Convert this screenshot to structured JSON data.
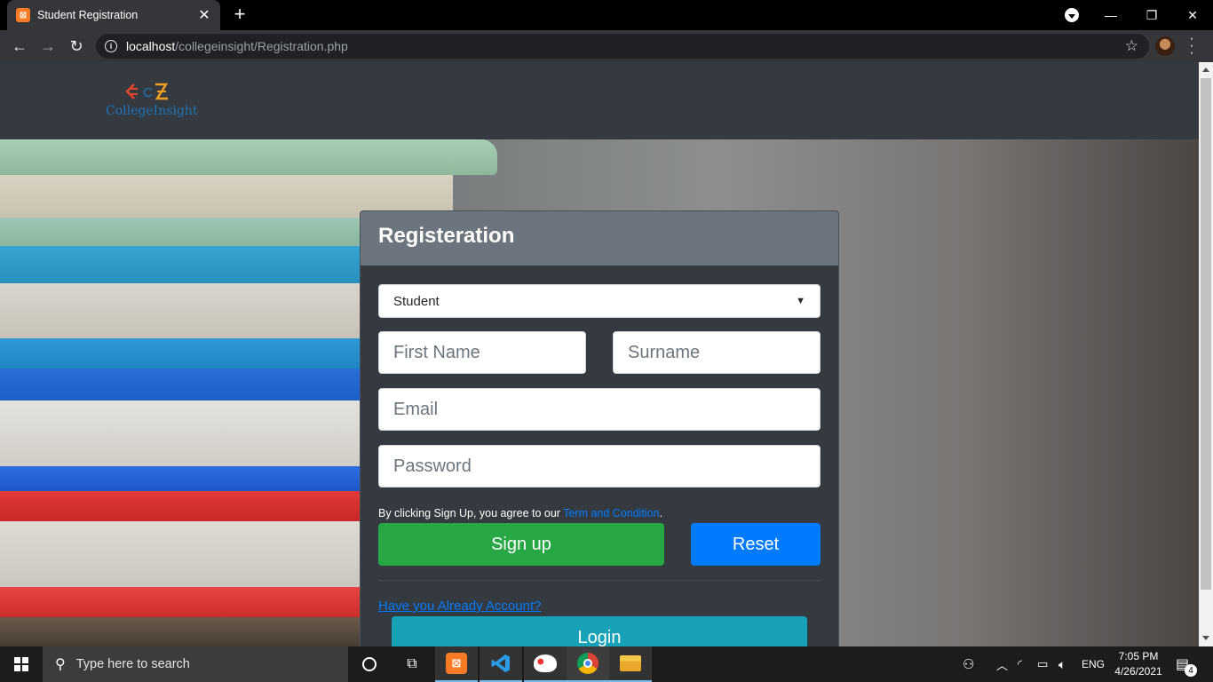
{
  "browser": {
    "tab_title": "Student Registration",
    "tab_icon": "xampp-icon",
    "url_host": "localhost",
    "url_path": "/collegeinsight/Registration.php"
  },
  "navbar": {
    "brand": "CollegeInsight"
  },
  "form": {
    "title": "Registeration",
    "role_selected": "Student",
    "first_name_placeholder": "First Name",
    "surname_placeholder": "Surname",
    "email_placeholder": "Email",
    "password_placeholder": "Password",
    "terms_prefix": "By clicking Sign Up, you agree to our",
    "terms_link": "Term and Condition",
    "terms_suffix": ".",
    "signup_label": "Sign up",
    "reset_label": "Reset",
    "already_account": "Have you Already Account?",
    "login_label": "Login"
  },
  "taskbar": {
    "search_placeholder": "Type here to search",
    "language": "ENG",
    "time": "7:05 PM",
    "date": "4/26/2021",
    "notification_count": "4"
  },
  "colors": {
    "navbar": "#343a40",
    "card": "#343a40",
    "card_header": "#6c757d",
    "signup": "#28a745",
    "reset": "#007bff",
    "login": "#17a2b8",
    "link": "#007bff"
  }
}
